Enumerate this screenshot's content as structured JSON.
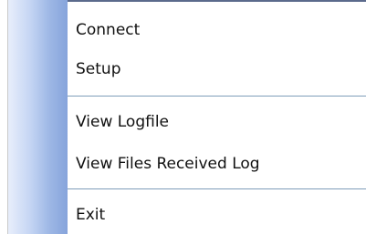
{
  "menu": {
    "items": [
      {
        "label": "Connect"
      },
      {
        "label": "Setup"
      },
      {
        "label": "View Logfile"
      },
      {
        "label": "View Files Received Log"
      },
      {
        "label": "Exit"
      }
    ]
  },
  "colors": {
    "separator": "#7f9db9",
    "gutter_light": "#e8eefb",
    "gutter_dark": "#86a4db",
    "top_edge": "#5b6a8c"
  }
}
